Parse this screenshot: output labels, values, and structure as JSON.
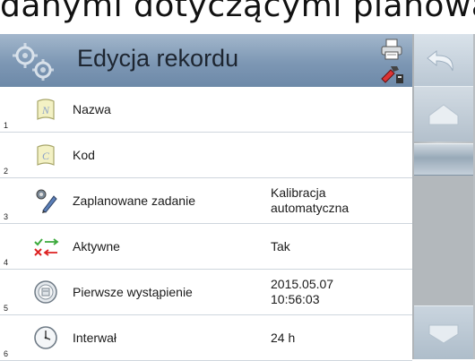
{
  "caption": {
    "text": "danymi dotyczącymi planowanej"
  },
  "header": {
    "title": "Edycja rekordu"
  },
  "rows": [
    {
      "num": "1",
      "label": "Nazwa",
      "value": ""
    },
    {
      "num": "2",
      "label": "Kod",
      "value": ""
    },
    {
      "num": "3",
      "label": "Zaplanowane zadanie",
      "value": "Kalibracja\nautomatyczna"
    },
    {
      "num": "4",
      "label": "Aktywne",
      "value": "Tak"
    },
    {
      "num": "5",
      "label": "Pierwsze wystąpienie",
      "value": "2015.05.07\n10:56:03"
    },
    {
      "num": "6",
      "label": "Interwał",
      "value": "24 h"
    }
  ],
  "icons": {
    "header": [
      "gears-icon",
      "printer-icon",
      "tools-icon"
    ],
    "rows": [
      "name-icon",
      "code-icon",
      "scheduled-task-icon",
      "active-checkmark-icon",
      "first-occurrence-icon",
      "clock-icon"
    ],
    "side": [
      "back-arrow-icon",
      "home-icon",
      "scroll-handle-icon",
      "down-arrow-icon"
    ]
  },
  "colors": {
    "header": "#7d97b4",
    "sidebar": "#b9bec2",
    "divider": "#cfd6dd"
  }
}
